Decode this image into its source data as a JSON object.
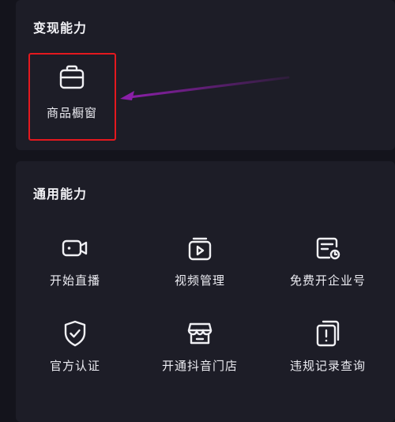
{
  "monetization": {
    "title": "变现能力",
    "items": [
      {
        "label": "商品橱窗",
        "icon": "shopping-bag-icon"
      }
    ]
  },
  "general": {
    "title": "通用能力",
    "items": [
      {
        "label": "开始直播",
        "icon": "live-camera-icon"
      },
      {
        "label": "视频管理",
        "icon": "video-manage-icon"
      },
      {
        "label": "免费开企业号",
        "icon": "enterprise-account-icon"
      },
      {
        "label": "官方认证",
        "icon": "shield-check-icon"
      },
      {
        "label": "开通抖音门店",
        "icon": "storefront-icon"
      },
      {
        "label": "违规记录查询",
        "icon": "violation-record-icon"
      }
    ]
  },
  "colors": {
    "background": "#14141c",
    "card": "#1d1d27",
    "highlight_box": "#e4181e",
    "arrow": "#8b1fa8"
  }
}
